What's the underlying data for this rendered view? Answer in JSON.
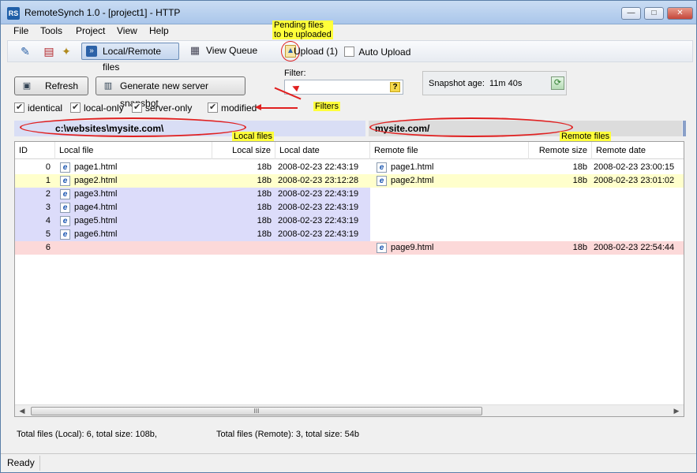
{
  "window": {
    "title": "RemoteSynch 1.0 - [project1] - HTTP",
    "app_icon": "RS",
    "controls": {
      "minimize": "—",
      "maximize": "□",
      "close": "✕"
    }
  },
  "menu": {
    "items": [
      "File",
      "Tools",
      "Project",
      "View",
      "Help"
    ]
  },
  "toolbar": {
    "local_remote": "Local/Remote files",
    "view_queue": "View Queue",
    "upload": "Upload (1)",
    "auto_upload": "Auto Upload",
    "auto_upload_checked": false,
    "icons": [
      "edit-project-icon",
      "settings-icon",
      "wizard-icon",
      "local-remote-icon",
      "view-queue-icon",
      "upload-icon"
    ]
  },
  "actions": {
    "refresh": "Refresh",
    "snapshot": "Generate new server snapshot"
  },
  "filter": {
    "label": "Filter:",
    "value": "",
    "help": "?"
  },
  "snapshot_age": {
    "label": "Snapshot age:",
    "value": "11m 40s"
  },
  "checkboxes": [
    {
      "label": "identical",
      "checked": true
    },
    {
      "label": "local-only",
      "checked": true
    },
    {
      "label": "server-only",
      "checked": true
    },
    {
      "label": "modified",
      "checked": true
    }
  ],
  "annotations": {
    "pending": [
      "Pending files",
      "to be uploaded"
    ],
    "filters": "Filters",
    "local_files": "Local files",
    "remote_files": "Remote files"
  },
  "paths": {
    "local": "c:\\websites\\mysite.com\\",
    "remote": "mysite.com/"
  },
  "grid": {
    "columns": [
      "ID",
      "Local file",
      "Local size",
      "Local date",
      "Remote file",
      "Remote size",
      "Remote date"
    ],
    "rows": [
      {
        "id": "0",
        "local_file": "page1.html",
        "local_size": "18b",
        "local_date": "2008-02-23 22:43:19",
        "remote_file": "page1.html",
        "remote_size": "18b",
        "remote_date": "2008-02-23 23:00:15",
        "status": "identical"
      },
      {
        "id": "1",
        "local_file": "page2.html",
        "local_size": "18b",
        "local_date": "2008-02-23 23:12:28",
        "remote_file": "page2.html",
        "remote_size": "18b",
        "remote_date": "2008-02-23 23:01:02",
        "status": "modified"
      },
      {
        "id": "2",
        "local_file": "page3.html",
        "local_size": "18b",
        "local_date": "2008-02-23 22:43:19",
        "remote_file": "",
        "remote_size": "",
        "remote_date": "",
        "status": "local-only"
      },
      {
        "id": "3",
        "local_file": "page4.html",
        "local_size": "18b",
        "local_date": "2008-02-23 22:43:19",
        "remote_file": "",
        "remote_size": "",
        "remote_date": "",
        "status": "local-only"
      },
      {
        "id": "4",
        "local_file": "page5.html",
        "local_size": "18b",
        "local_date": "2008-02-23 22:43:19",
        "remote_file": "",
        "remote_size": "",
        "remote_date": "",
        "status": "local-only"
      },
      {
        "id": "5",
        "local_file": "page6.html",
        "local_size": "18b",
        "local_date": "2008-02-23 22:43:19",
        "remote_file": "",
        "remote_size": "",
        "remote_date": "",
        "status": "local-only"
      },
      {
        "id": "6",
        "local_file": "",
        "local_size": "",
        "local_date": "",
        "remote_file": "page9.html",
        "remote_size": "18b",
        "remote_date": "2008-02-23 22:54:44",
        "status": "server-only"
      }
    ],
    "scroll_thumb": "III",
    "scroll_left": "◀",
    "scroll_right": "▶"
  },
  "colors": {
    "identical": "#ffffff",
    "modified": "#ffffcc",
    "local-only": "#dcdcfa",
    "server-only": "#fcd9d9",
    "annotation": "#ffff3a",
    "annotation_line": "#e02020"
  },
  "totals": {
    "local": "Total files (Local): 6, total size: 108b,",
    "remote": "Total files (Remote): 3, total size: 54b"
  },
  "status": "Ready"
}
